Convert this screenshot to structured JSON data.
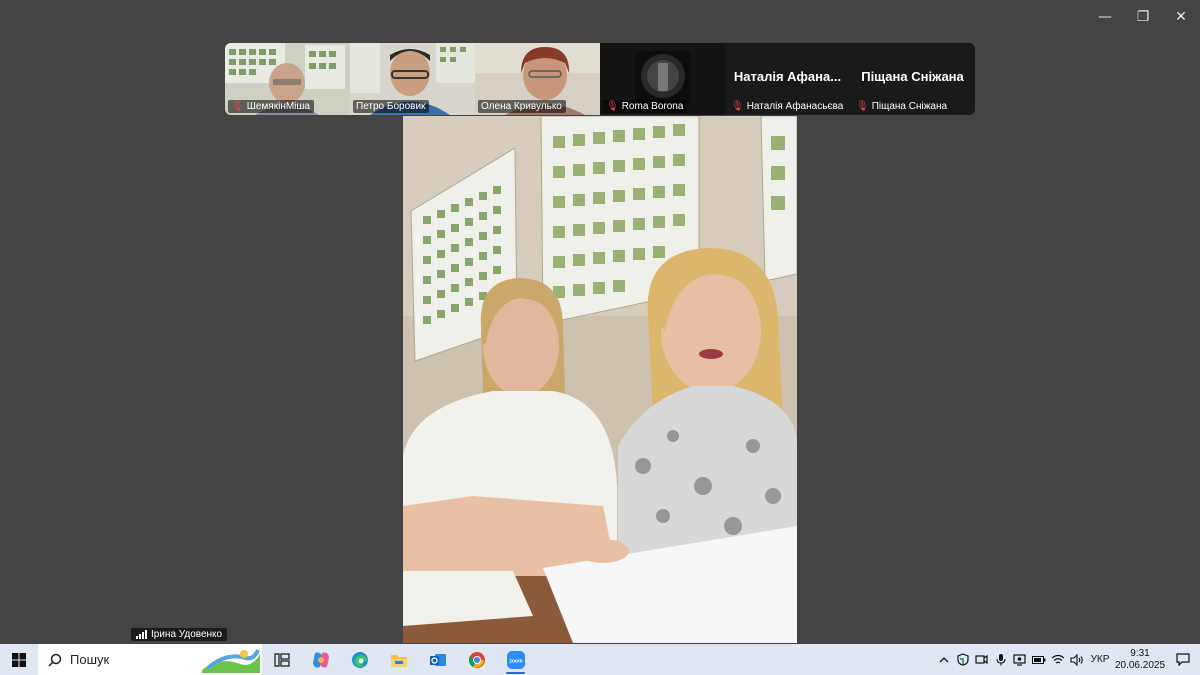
{
  "window": {
    "minimize_glyph": "—",
    "restore_glyph": "❐",
    "close_glyph": "✕"
  },
  "participants": [
    {
      "name": "ШемякінМіша",
      "muted": true
    },
    {
      "name": "Петро Боровик",
      "muted": false
    },
    {
      "name": "Олена Кривулько",
      "muted": false
    },
    {
      "name": "Roma Borona",
      "muted": true
    },
    {
      "name": "Наталія Афанасьєва",
      "title": "Наталія Афана...",
      "muted": true
    },
    {
      "name": "Піщана Сніжана",
      "title": "Піщана Сніжана",
      "muted": true
    }
  ],
  "speaker": {
    "name": "Ірина Удовенко"
  },
  "taskbar": {
    "search_placeholder": "Пошук",
    "apps": [
      "task-view",
      "copilot",
      "edge",
      "file-explorer",
      "outlook",
      "chrome",
      "zoom"
    ],
    "zoom_label": "zoom",
    "language": "УКР",
    "time": "9:31",
    "date": "20.06.2025"
  },
  "colors": {
    "background": "#444444",
    "taskbar": "#dfe8f2",
    "muted_icon": "#e5484d",
    "zoom_blue": "#2d8cff"
  }
}
